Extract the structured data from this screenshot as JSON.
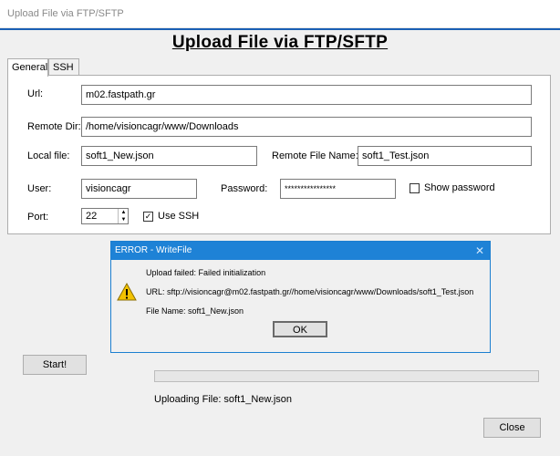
{
  "window": {
    "title": "Upload File via FTP/SFTP"
  },
  "heading": "Upload File via FTP/SFTP",
  "tabs": [
    {
      "label": "General"
    },
    {
      "label": "SSH"
    }
  ],
  "form": {
    "url_label": "Url:",
    "url_value": "m02.fastpath.gr",
    "remote_dir_label": "Remote Dir:",
    "remote_dir_value": "/home/visioncagr/www/Downloads",
    "local_file_label": "Local file:",
    "local_file_value": "soft1_New.json",
    "remote_file_label": "Remote File Name:",
    "remote_file_value": "soft1_Test.json",
    "user_label": "User:",
    "user_value": "visioncagr",
    "password_label": "Password:",
    "password_value": "****************",
    "show_password_label": "Show password",
    "show_password_checked": false,
    "port_label": "Port:",
    "port_value": "22",
    "use_ssh_label": "Use SSH",
    "use_ssh_checked": true
  },
  "dialog": {
    "title": "ERROR - WriteFile",
    "line1": "Upload failed: Failed initialization",
    "line2": "URL: sftp://visioncagr@m02.fastpath.gr//home/visioncagr/www/Downloads/soft1_Test.json",
    "line3": "File Name: soft1_New.json",
    "ok_label": "OK",
    "close_glyph": "✕"
  },
  "actions": {
    "start_label": "Start!",
    "close_label": "Close"
  },
  "status": {
    "text": "Uploading File: soft1_New.json",
    "progress": 0
  },
  "colors": {
    "accent": "#1e82d6",
    "error_icon": "#f2c200"
  }
}
